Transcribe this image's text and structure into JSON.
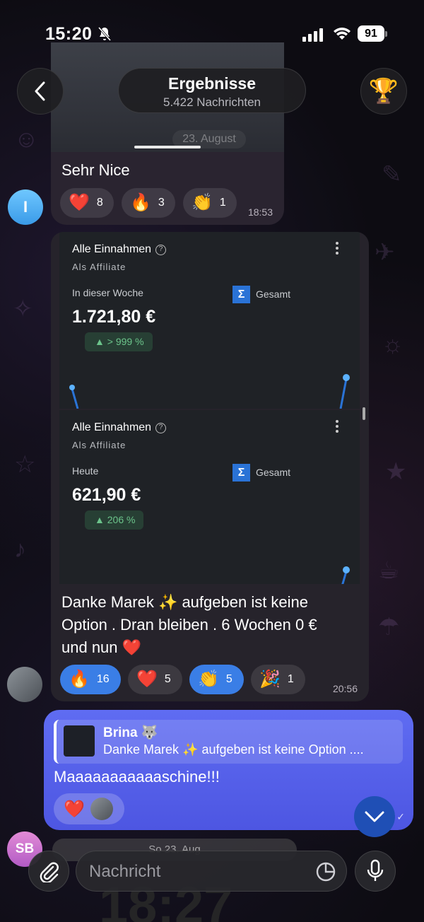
{
  "status_bar": {
    "time": "15:20",
    "battery": "91"
  },
  "header": {
    "title": "Ergebnisse",
    "subtitle": "5.422 Nachrichten"
  },
  "messages": [
    {
      "media_date_overlay": "23. August",
      "caption": "Sehr Nice",
      "time": "18:53",
      "avatar_initial": "I",
      "reactions": [
        {
          "emoji": "❤️",
          "count": "8"
        },
        {
          "emoji": "🔥",
          "count": "3"
        },
        {
          "emoji": "👏",
          "count": "1"
        }
      ]
    },
    {
      "cards": [
        {
          "title": "Alle Einnahmen",
          "subtitle": "Als Affiliate",
          "period": "In dieser Woche",
          "total_label": "Gesamt",
          "amount": "1.721,80 €",
          "delta": "> 999 %"
        },
        {
          "title": "Alle Einnahmen",
          "subtitle": "Als Affiliate",
          "period": "Heute",
          "total_label": "Gesamt",
          "amount": "621,90 €",
          "delta": "206 %"
        }
      ],
      "caption_line1": "Danke Marek ✨  aufgeben ist keine",
      "caption_line2": "Option . Dran bleiben . 6 Wochen 0 €",
      "caption_line3": "und nun ❤️",
      "time": "20:56",
      "reactions": [
        {
          "emoji": "🔥",
          "count": "16",
          "active": true
        },
        {
          "emoji": "❤️",
          "count": "5",
          "active": false
        },
        {
          "emoji": "👏",
          "count": "5",
          "active": true
        },
        {
          "emoji": "🎉",
          "count": "1",
          "active": false
        }
      ]
    },
    {
      "reply_name": "Brina 🐺",
      "reply_text": "Danke Marek ✨  aufgeben ist keine Option ....",
      "text": "Maaaaaaaaaaaschine!!!",
      "reaction_emoji": "❤️",
      "avatar_initials": "SB"
    }
  ],
  "bottom": {
    "date_pill": "So 23. Aug",
    "ghost_time": "18:27",
    "input_placeholder": "Nachricht"
  },
  "colors": {
    "accent": "#3a7ee6",
    "own_bubble": "#5b66ee",
    "bubble": "#26232b",
    "positive": "#6cc48b"
  },
  "icons": [
    "back-arrow-icon",
    "trophy-icon",
    "bell-off-icon",
    "paperclip-icon",
    "sticker-icon",
    "microphone-icon",
    "chevron-down-icon",
    "sigma-icon",
    "more-vertical-icon",
    "help-circle-icon"
  ]
}
